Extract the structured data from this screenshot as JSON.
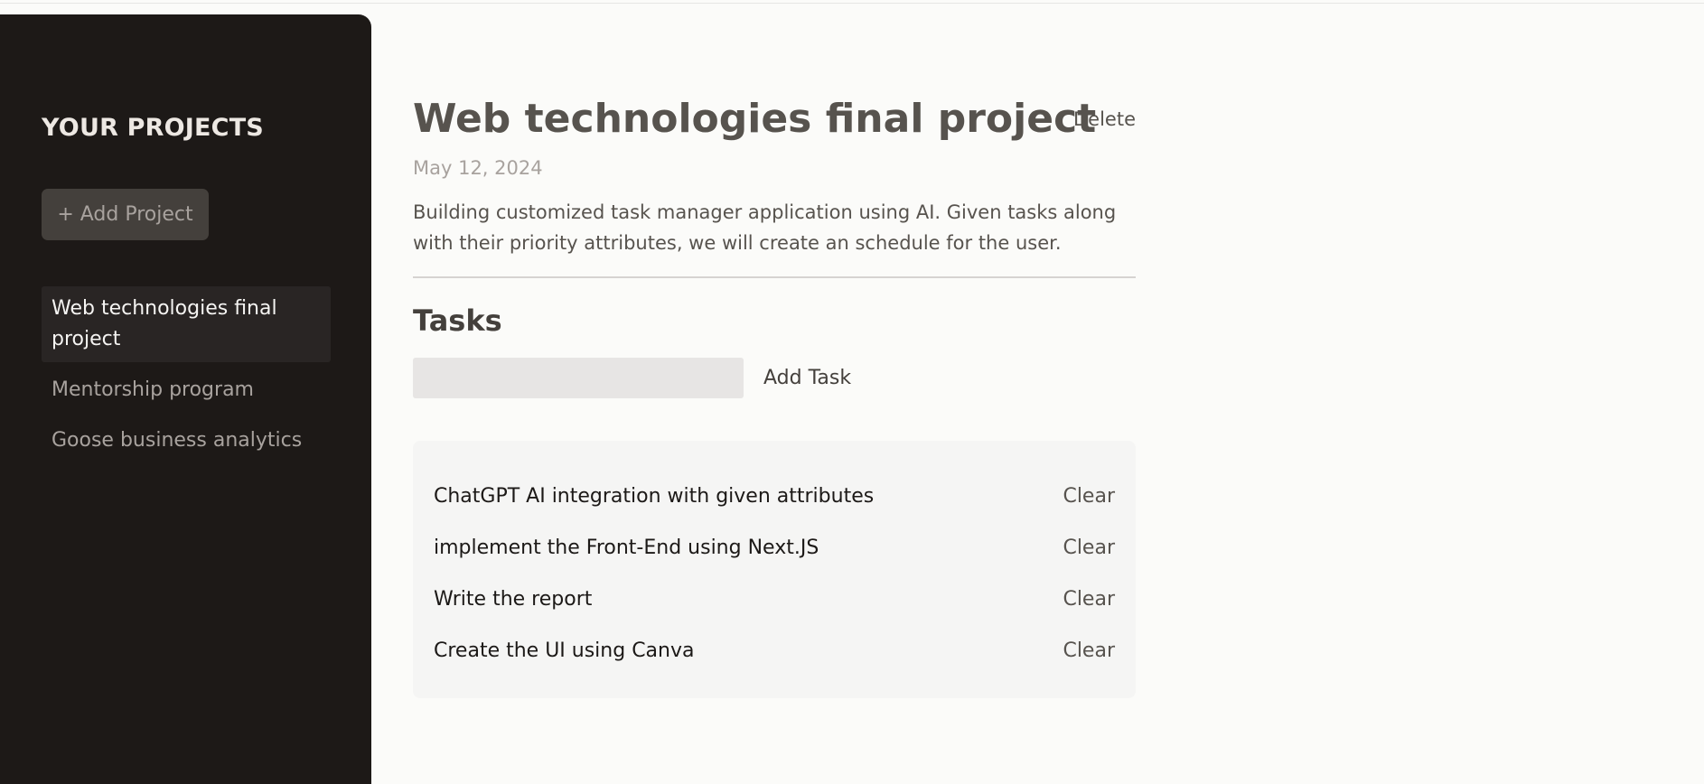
{
  "sidebar": {
    "title": "YOUR PROJECTS",
    "add_project_label": "+ Add Project",
    "projects": [
      {
        "label": "Web technologies final project",
        "active": true
      },
      {
        "label": "Mentorship program",
        "active": false
      },
      {
        "label": "Goose business analytics",
        "active": false
      }
    ]
  },
  "project": {
    "title": "Web technologies final project",
    "delete_label": "Delete",
    "date": "May 12, 2024",
    "description": "Building customized task manager application using AI. Given tasks along with their priority attributes, we will create an schedule for the user."
  },
  "tasks": {
    "heading": "Tasks",
    "input_value": "",
    "add_task_label": "Add Task",
    "clear_label": "Clear",
    "items": [
      {
        "text": "ChatGPT AI integration with given attributes"
      },
      {
        "text": "implement the Front-End using Next.JS"
      },
      {
        "text": "Write the report"
      },
      {
        "text": "Create the UI using Canva"
      }
    ]
  },
  "colors": {
    "sidebar_bg": "#1d1917",
    "page_bg": "#fbfbf9",
    "active_item_bg": "#292524",
    "task_list_bg": "#f5f5f4"
  }
}
